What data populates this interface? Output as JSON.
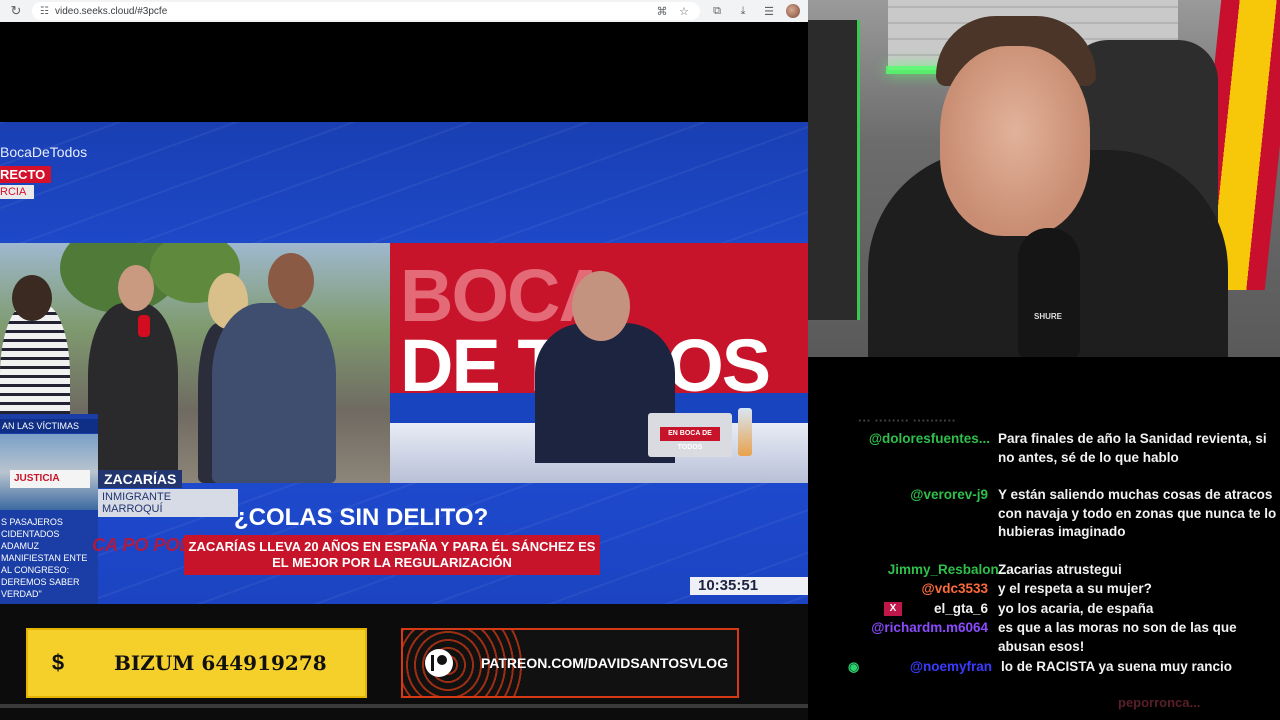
{
  "browser": {
    "url": "video.seeks.cloud/#3pcfe"
  },
  "video": {
    "hashtag": "BocaDeTodos",
    "live_label": "RECTO",
    "location_label": "RCIA",
    "studio_backdrop": [
      "BOCA",
      "DE TODOS"
    ],
    "laptop_logo": "EN BOCA DE TODOS",
    "side_label": "AN LAS VÍCTIMAS",
    "side_banner": "JUSTICIA",
    "side_text": "S PASAJEROS CIDENTADOS ADAMUZ MANIFIESTAN ENTE AL CONGRESO: DEREMOS SABER VERDAD\"",
    "name": "ZACARÍAS",
    "role": "INMIGRANTE MARROQUÍ",
    "headline": "¿COLAS SIN DELITO?",
    "subheadline": "ZACARÍAS LLEVA 20 AÑOS EN ESPAÑA Y PARA ÉL SÁNCHEZ ES EL MEJOR POR LA REGULARIZACIÓN",
    "show_logo": "CA PO POLÉMIC",
    "clock": "10:35:51"
  },
  "banners": {
    "bizum_icon": "$",
    "bizum_label": "BIZUM 644919278",
    "patreon_label": "PATREON.COM/DAVIDSANTOSVLOG"
  },
  "webcam": {
    "mic_brand": "SHURE"
  },
  "chat": {
    "cut_off_line": "··· ········ ··········",
    "messages": [
      {
        "user": "@doloresfuentes...",
        "color": "#2fbf4a",
        "text": "Para finales de año la Sanidad revienta, si no antes, sé de lo que hablo"
      },
      {
        "user": "@verorev-j9",
        "color": "#2fbf4a",
        "text": "Y están saliendo muchas cosas de atracos con navaja y todo en zonas que nunca te lo hubieras imaginado"
      },
      {
        "user": "Jimmy_Resbalon...",
        "color": "#2fbf4a",
        "text": "Zacarias atrustegui"
      },
      {
        "user": "@vdc3533",
        "color": "#ff6b3a",
        "text": "y el respeta a su mujer?"
      },
      {
        "user": "el_gta_6",
        "color": "#f2f2f2",
        "text": "yo los acaria, de españa"
      },
      {
        "user": "@richardm.m6064",
        "color": "#8a4bff",
        "text": "es que a las moras no son de las que abusan esos!"
      },
      {
        "user": "@noemyfran",
        "color": "#3b3bff",
        "text": "lo de RACISTA ya suena muy rancio"
      }
    ],
    "badge_x": "X",
    "footer_user": "peporronca..."
  }
}
